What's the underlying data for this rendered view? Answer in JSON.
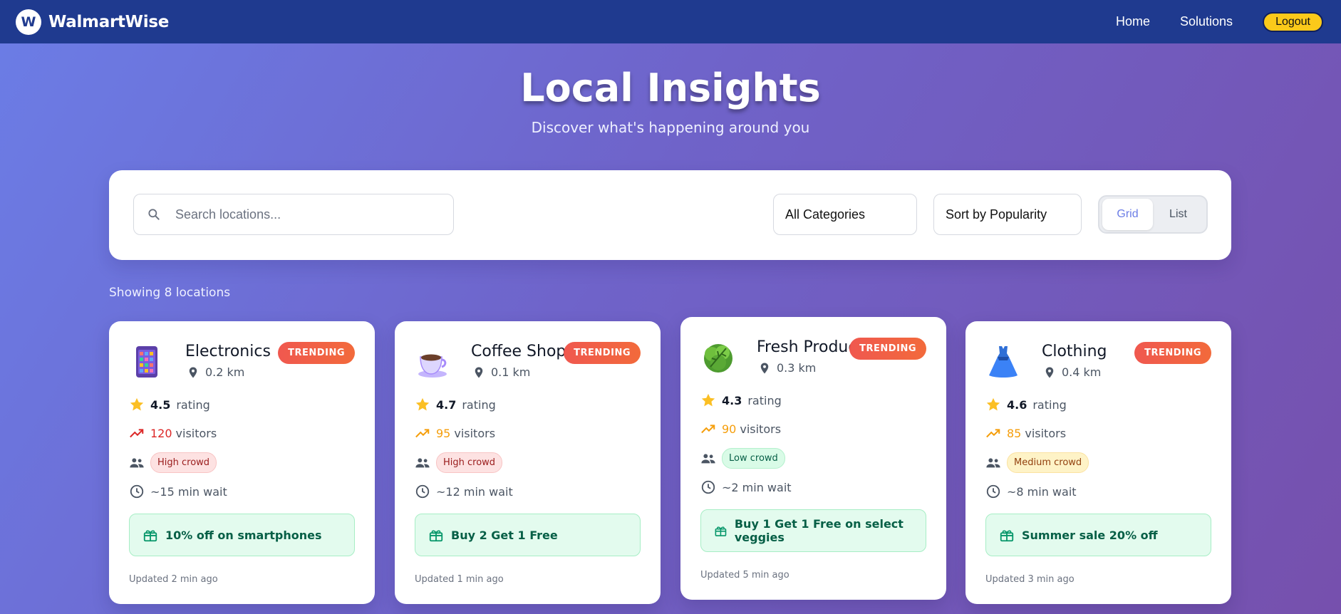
{
  "nav": {
    "logo_letter": "W",
    "brand": "WalmartWise",
    "links": [
      "Home",
      "Solutions"
    ],
    "logout": "Logout"
  },
  "hero": {
    "title": "Local Insights",
    "subtitle": "Discover what's happening around you"
  },
  "filters": {
    "search_placeholder": "Search locations...",
    "category": "All Categories",
    "sort": "Sort by Popularity",
    "view_grid": "Grid",
    "view_list": "List",
    "active_view": "Grid"
  },
  "results": {
    "showing": "Showing 8 locations"
  },
  "colors": {
    "nav_bg": "#1f3a8f",
    "accent_yellow": "#fbc91a",
    "badge_red": "#f0584f",
    "offer_green": "#065f46"
  },
  "cards": [
    {
      "icon": "phone-icon",
      "name": "Electronics",
      "badge": "TRENDING",
      "distance": "0.2 km",
      "rating": "4.5",
      "rating_label": "rating",
      "visitors": "120",
      "visitors_label": "visitors",
      "crowd": "High crowd",
      "wait": "~15 min wait",
      "offer": "10% off on smartphones",
      "updated": "Updated 2 min ago"
    },
    {
      "icon": "coffee-icon",
      "name": "Coffee Shop",
      "badge": "TRENDING",
      "distance": "0.1 km",
      "rating": "4.7",
      "rating_label": "rating",
      "visitors": "95",
      "visitors_label": "visitors",
      "crowd": "High crowd",
      "wait": "~12 min wait",
      "offer": "Buy 2 Get 1 Free",
      "updated": "Updated 1 min ago"
    },
    {
      "icon": "lettuce-icon",
      "name": "Fresh Produce",
      "badge": "TRENDING",
      "distance": "0.3 km",
      "rating": "4.3",
      "rating_label": "rating",
      "visitors": "90",
      "visitors_label": "visitors",
      "crowd": "Low crowd",
      "wait": "~2 min wait",
      "offer": "Buy 1 Get 1 Free on select veggies",
      "updated": "Updated 5 min ago"
    },
    {
      "icon": "dress-icon",
      "name": "Clothing",
      "badge": "TRENDING",
      "distance": "0.4 km",
      "rating": "4.6",
      "rating_label": "rating",
      "visitors": "85",
      "visitors_label": "visitors",
      "crowd": "Medium crowd",
      "wait": "~8 min wait",
      "offer": "Summer sale 20% off",
      "updated": "Updated 3 min ago"
    }
  ]
}
